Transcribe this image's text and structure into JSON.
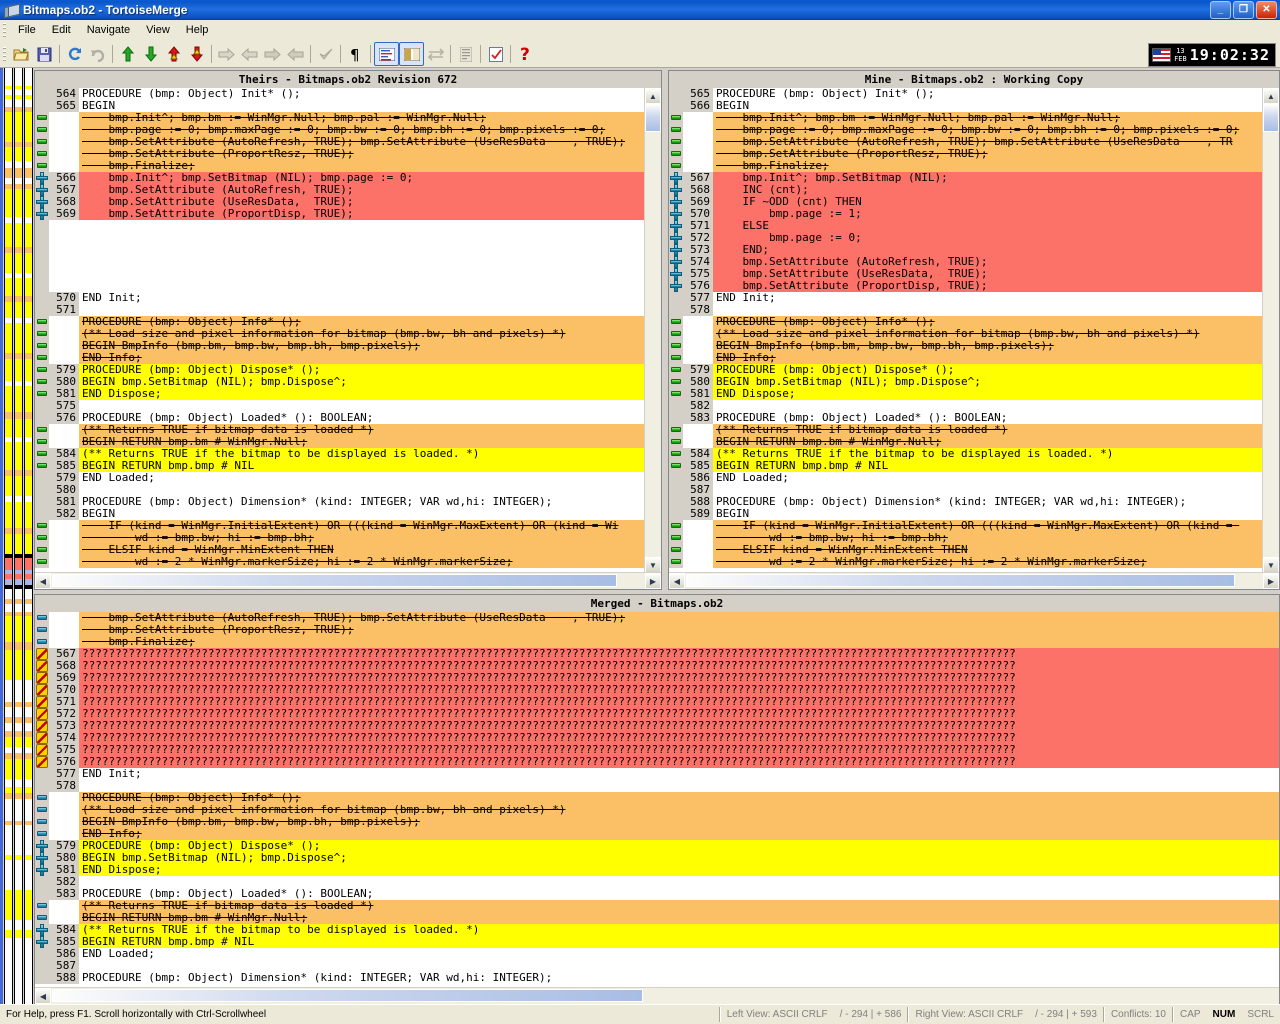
{
  "window": {
    "title": "Bitmaps.ob2 - TortoiseMerge",
    "minimize": "_",
    "maximize": "❐",
    "close": "✕"
  },
  "menu": [
    "File",
    "Edit",
    "Navigate",
    "View",
    "Help"
  ],
  "toolbar": {
    "buttons": [
      "open-icon",
      "save-icon",
      "sep",
      "reload-icon",
      "undo-icon",
      "sep",
      "prev-diff-icon",
      "next-diff-icon",
      "prev-conflict-icon",
      "next-conflict-icon",
      "sep",
      "use-theirs-block-icon",
      "use-mine-block-icon",
      "use-theirs-then-mine-icon",
      "use-mine-then-theirs-icon",
      "sep",
      "mark-resolved-icon",
      "sep",
      "whitespace-icon",
      "sep",
      "one-pane-view-icon",
      "two-pane-view-icon",
      "switch-view-icon",
      "sep",
      "three-pane-view-icon",
      "sep",
      "settings-icon",
      "sep",
      "help-icon"
    ]
  },
  "clock": {
    "day": "13",
    "month": "FEB",
    "time": "19:02:32",
    "flag": "us-flag-icon"
  },
  "panes": {
    "left": {
      "title": "Theirs - Bitmaps.ob2 Revision 672"
    },
    "right": {
      "title": "Mine - Bitmaps.ob2 : Working Copy"
    },
    "merged": {
      "title": "Merged - Bitmaps.ob2"
    }
  },
  "left_lines": [
    {
      "n": "564",
      "t": "PROCEDURE (bmp: Object) Init* ();",
      "s": "norm",
      "m": ""
    },
    {
      "n": "565",
      "t": "BEGIN",
      "s": "norm",
      "m": ""
    },
    {
      "n": "",
      "t": "    bmp.Init^; bmp.bm := WinMgr.Null; bmp.pal := WinMgr.Null;",
      "s": "rem",
      "m": "rem"
    },
    {
      "n": "",
      "t": "    bmp.page := 0; bmp.maxPage := 0; bmp.bw := 0; bmp.bh := 0; bmp.pixels := 0;",
      "s": "rem",
      "m": "rem"
    },
    {
      "n": "",
      "t": "    bmp.SetAttribute (AutoRefresh, TRUE); bmp.SetAttribute (UseResData    , TRUE);",
      "s": "rem",
      "m": "rem"
    },
    {
      "n": "",
      "t": "    bmp.SetAttribute (ProportResz, TRUE);",
      "s": "rem",
      "m": "rem"
    },
    {
      "n": "",
      "t": "    bmp.Finalize;",
      "s": "rem",
      "m": "rem"
    },
    {
      "n": "566",
      "t": "    bmp.Init^; bmp.SetBitmap (NIL); bmp.page := 0;",
      "s": "conf",
      "m": "add"
    },
    {
      "n": "567",
      "t": "    bmp.SetAttribute (AutoRefresh, TRUE);",
      "s": "conf",
      "m": "add"
    },
    {
      "n": "568",
      "t": "    bmp.SetAttribute (UseResData,  TRUE);",
      "s": "conf",
      "m": "add"
    },
    {
      "n": "569",
      "t": "    bmp.SetAttribute (ProportDisp, TRUE);",
      "s": "conf",
      "m": "add"
    },
    {
      "n": "",
      "t": "",
      "s": "conf",
      "m": ""
    },
    {
      "n": "",
      "t": "",
      "s": "conf",
      "m": ""
    },
    {
      "n": "",
      "t": "",
      "s": "conf",
      "m": ""
    },
    {
      "n": "",
      "t": "",
      "s": "conf",
      "m": ""
    },
    {
      "n": "",
      "t": "",
      "s": "conf",
      "m": ""
    },
    {
      "n": "",
      "t": "",
      "s": "conf",
      "m": ""
    },
    {
      "n": "570",
      "t": "END Init;",
      "s": "norm",
      "m": ""
    },
    {
      "n": "571",
      "t": "",
      "s": "norm",
      "m": ""
    },
    {
      "n": "",
      "t": "PROCEDURE (bmp: Object) Info* ();",
      "s": "rem",
      "m": "rem"
    },
    {
      "n": "",
      "t": "(** Load size and pixel information for bitmap (bmp.bw, bh and pixels) *)",
      "s": "rem",
      "m": "rem"
    },
    {
      "n": "",
      "t": "BEGIN BmpInfo (bmp.bm, bmp.bw, bmp.bh, bmp.pixels);",
      "s": "rem",
      "m": "rem"
    },
    {
      "n": "",
      "t": "END Info;",
      "s": "rem",
      "m": "rem"
    },
    {
      "n": "579",
      "t": "PROCEDURE (bmp: Object) Dispose* ();",
      "s": "mod",
      "m": "rem"
    },
    {
      "n": "580",
      "t": "BEGIN bmp.SetBitmap (NIL); bmp.Dispose^;",
      "s": "mod",
      "m": "rem"
    },
    {
      "n": "581",
      "t": "END Dispose;",
      "s": "mod",
      "m": "rem"
    },
    {
      "n": "575",
      "t": "",
      "s": "norm",
      "m": ""
    },
    {
      "n": "576",
      "t": "PROCEDURE (bmp: Object) Loaded* (): BOOLEAN;",
      "s": "norm",
      "m": ""
    },
    {
      "n": "",
      "t": "(** Returns TRUE if bitmap data is loaded *)",
      "s": "rem",
      "m": "rem"
    },
    {
      "n": "",
      "t": "BEGIN RETURN bmp.bm # WinMgr.Null;",
      "s": "rem",
      "m": "rem"
    },
    {
      "n": "584",
      "t": "(** Returns TRUE if the bitmap to be displayed is loaded. *)",
      "s": "mod",
      "m": "rem"
    },
    {
      "n": "585",
      "t": "BEGIN RETURN bmp.bmp # NIL",
      "s": "mod",
      "m": "rem"
    },
    {
      "n": "579",
      "t": "END Loaded;",
      "s": "norm",
      "m": ""
    },
    {
      "n": "580",
      "t": "",
      "s": "norm",
      "m": ""
    },
    {
      "n": "581",
      "t": "PROCEDURE (bmp: Object) Dimension* (kind: INTEGER; VAR wd,hi: INTEGER);",
      "s": "norm",
      "m": ""
    },
    {
      "n": "582",
      "t": "BEGIN",
      "s": "norm",
      "m": ""
    },
    {
      "n": "",
      "t": "    IF (kind = WinMgr.InitialExtent) OR (((kind = WinMgr.MaxExtent) OR (kind = Wi",
      "s": "rem",
      "m": "rem"
    },
    {
      "n": "",
      "t": "        wd := bmp.bw; hi := bmp.bh;",
      "s": "rem",
      "m": "rem"
    },
    {
      "n": "",
      "t": "    ELSIF kind = WinMgr.MinExtent THEN",
      "s": "rem",
      "m": "rem"
    },
    {
      "n": "",
      "t": "        wd := 2 * WinMgr.markerSize; hi := 2 * WinMgr.markerSize;",
      "s": "rem",
      "m": "rem"
    }
  ],
  "right_lines": [
    {
      "n": "565",
      "t": "PROCEDURE (bmp: Object) Init* ();",
      "s": "norm",
      "m": ""
    },
    {
      "n": "566",
      "t": "BEGIN",
      "s": "norm",
      "m": ""
    },
    {
      "n": "",
      "t": "    bmp.Init^; bmp.bm := WinMgr.Null; bmp.pal := WinMgr.Null;",
      "s": "rem",
      "m": "rem"
    },
    {
      "n": "",
      "t": "    bmp.page := 0; bmp.maxPage := 0; bmp.bw := 0; bmp.bh := 0; bmp.pixels := 0;",
      "s": "rem",
      "m": "rem"
    },
    {
      "n": "",
      "t": "    bmp.SetAttribute (AutoRefresh, TRUE); bmp.SetAttribute (UseResData    , TR",
      "s": "rem",
      "m": "rem"
    },
    {
      "n": "",
      "t": "    bmp.SetAttribute (ProportResz, TRUE);",
      "s": "rem",
      "m": "rem"
    },
    {
      "n": "",
      "t": "    bmp.Finalize;",
      "s": "rem",
      "m": "rem"
    },
    {
      "n": "567",
      "t": "    bmp.Init^; bmp.SetBitmap (NIL);",
      "s": "conf",
      "m": "add"
    },
    {
      "n": "568",
      "t": "    INC (cnt);",
      "s": "conf",
      "m": "add"
    },
    {
      "n": "569",
      "t": "    IF ~ODD (cnt) THEN",
      "s": "conf",
      "m": "add"
    },
    {
      "n": "570",
      "t": "        bmp.page := 1;",
      "s": "conf",
      "m": "add"
    },
    {
      "n": "571",
      "t": "    ELSE",
      "s": "conf",
      "m": "add"
    },
    {
      "n": "572",
      "t": "        bmp.page := 0;",
      "s": "conf",
      "m": "add"
    },
    {
      "n": "573",
      "t": "    END;",
      "s": "conf",
      "m": "add"
    },
    {
      "n": "574",
      "t": "    bmp.SetAttribute (AutoRefresh, TRUE);",
      "s": "conf",
      "m": "add"
    },
    {
      "n": "575",
      "t": "    bmp.SetAttribute (UseResData,  TRUE);",
      "s": "conf",
      "m": "add"
    },
    {
      "n": "576",
      "t": "    bmp.SetAttribute (ProportDisp, TRUE);",
      "s": "conf",
      "m": "add"
    },
    {
      "n": "577",
      "t": "END Init;",
      "s": "norm",
      "m": ""
    },
    {
      "n": "578",
      "t": "",
      "s": "norm",
      "m": ""
    },
    {
      "n": "",
      "t": "PROCEDURE (bmp: Object) Info* ();",
      "s": "rem",
      "m": "rem"
    },
    {
      "n": "",
      "t": "(** Load size and pixel information for bitmap (bmp.bw, bh and pixels) *)",
      "s": "rem",
      "m": "rem"
    },
    {
      "n": "",
      "t": "BEGIN BmpInfo (bmp.bm, bmp.bw, bmp.bh, bmp.pixels);",
      "s": "rem",
      "m": "rem"
    },
    {
      "n": "",
      "t": "END Info;",
      "s": "rem",
      "m": "rem"
    },
    {
      "n": "579",
      "t": "PROCEDURE (bmp: Object) Dispose* ();",
      "s": "mod",
      "m": "rem"
    },
    {
      "n": "580",
      "t": "BEGIN bmp.SetBitmap (NIL); bmp.Dispose^;",
      "s": "mod",
      "m": "rem"
    },
    {
      "n": "581",
      "t": "END Dispose;",
      "s": "mod",
      "m": "rem"
    },
    {
      "n": "582",
      "t": "",
      "s": "norm",
      "m": ""
    },
    {
      "n": "583",
      "t": "PROCEDURE (bmp: Object) Loaded* (): BOOLEAN;",
      "s": "norm",
      "m": ""
    },
    {
      "n": "",
      "t": "(** Returns TRUE if bitmap data is loaded *)",
      "s": "rem",
      "m": "rem"
    },
    {
      "n": "",
      "t": "BEGIN RETURN bmp.bm # WinMgr.Null;",
      "s": "rem",
      "m": "rem"
    },
    {
      "n": "584",
      "t": "(** Returns TRUE if the bitmap to be displayed is loaded. *)",
      "s": "mod",
      "m": "rem"
    },
    {
      "n": "585",
      "t": "BEGIN RETURN bmp.bmp # NIL",
      "s": "mod",
      "m": "rem"
    },
    {
      "n": "586",
      "t": "END Loaded;",
      "s": "norm",
      "m": ""
    },
    {
      "n": "587",
      "t": "",
      "s": "norm",
      "m": ""
    },
    {
      "n": "588",
      "t": "PROCEDURE (bmp: Object) Dimension* (kind: INTEGER; VAR wd,hi: INTEGER);",
      "s": "norm",
      "m": ""
    },
    {
      "n": "589",
      "t": "BEGIN",
      "s": "norm",
      "m": ""
    },
    {
      "n": "",
      "t": "    IF (kind = WinMgr.InitialExtent) OR (((kind = WinMgr.MaxExtent) OR (kind = ",
      "s": "rem",
      "m": "rem"
    },
    {
      "n": "",
      "t": "        wd := bmp.bw; hi := bmp.bh;",
      "s": "rem",
      "m": "rem"
    },
    {
      "n": "",
      "t": "    ELSIF kind = WinMgr.MinExtent THEN",
      "s": "rem",
      "m": "rem"
    },
    {
      "n": "",
      "t": "        wd := 2 * WinMgr.markerSize; hi := 2 * WinMgr.markerSize;",
      "s": "rem",
      "m": "rem"
    }
  ],
  "merged_lines": [
    {
      "n": "",
      "t": "    bmp.SetAttribute (AutoRefresh, TRUE); bmp.SetAttribute (UseResData    , TRUE);",
      "s": "rem",
      "m": "teal"
    },
    {
      "n": "",
      "t": "    bmp.SetAttribute (ProportResz, TRUE);",
      "s": "rem",
      "m": "teal"
    },
    {
      "n": "",
      "t": "    bmp.Finalize;",
      "s": "rem",
      "m": "teal"
    },
    {
      "n": "567",
      "t": "?????????????????????????????????????????????????????????????????????????????????????????????????????????????????????????????????????????????",
      "s": "conf",
      "m": "conf"
    },
    {
      "n": "568",
      "t": "?????????????????????????????????????????????????????????????????????????????????????????????????????????????????????????????????????????????",
      "s": "conf",
      "m": "conf"
    },
    {
      "n": "569",
      "t": "?????????????????????????????????????????????????????????????????????????????????????????????????????????????????????????????????????????????",
      "s": "conf",
      "m": "conf"
    },
    {
      "n": "570",
      "t": "?????????????????????????????????????????????????????????????????????????????????????????????????????????????????????????????????????????????",
      "s": "conf",
      "m": "conf"
    },
    {
      "n": "571",
      "t": "?????????????????????????????????????????????????????????????????????????????????????????????????????????????????????????????????????????????",
      "s": "conf",
      "m": "conf"
    },
    {
      "n": "572",
      "t": "?????????????????????????????????????????????????????????????????????????????????????????????????????????????????????????????????????????????",
      "s": "conf",
      "m": "conf"
    },
    {
      "n": "573",
      "t": "?????????????????????????????????????????????????????????????????????????????????????????????????????????????????????????????????????????????",
      "s": "conf",
      "m": "conf"
    },
    {
      "n": "574",
      "t": "?????????????????????????????????????????????????????????????????????????????????????????????????????????????????????????????????????????????",
      "s": "conf",
      "m": "conf"
    },
    {
      "n": "575",
      "t": "?????????????????????????????????????????????????????????????????????????????????????????????????????????????????????????????????????????????",
      "s": "conf",
      "m": "conf"
    },
    {
      "n": "576",
      "t": "?????????????????????????????????????????????????????????????????????????????????????????????????????????????????????????????????????????????",
      "s": "conf",
      "m": "conf"
    },
    {
      "n": "577",
      "t": "END Init;",
      "s": "norm",
      "m": ""
    },
    {
      "n": "578",
      "t": "",
      "s": "norm",
      "m": ""
    },
    {
      "n": "",
      "t": "PROCEDURE (bmp: Object) Info* ();",
      "s": "rem",
      "m": "teal"
    },
    {
      "n": "",
      "t": "(** Load size and pixel information for bitmap (bmp.bw, bh and pixels) *)",
      "s": "rem",
      "m": "teal"
    },
    {
      "n": "",
      "t": "BEGIN BmpInfo (bmp.bm, bmp.bw, bmp.bh, bmp.pixels);",
      "s": "rem",
      "m": "teal"
    },
    {
      "n": "",
      "t": "END Info;",
      "s": "rem",
      "m": "teal"
    },
    {
      "n": "579",
      "t": "PROCEDURE (bmp: Object) Dispose* ();",
      "s": "mod",
      "m": "add"
    },
    {
      "n": "580",
      "t": "BEGIN bmp.SetBitmap (NIL); bmp.Dispose^;",
      "s": "mod",
      "m": "add"
    },
    {
      "n": "581",
      "t": "END Dispose;",
      "s": "mod",
      "m": "add"
    },
    {
      "n": "582",
      "t": "",
      "s": "norm",
      "m": ""
    },
    {
      "n": "583",
      "t": "PROCEDURE (bmp: Object) Loaded* (): BOOLEAN;",
      "s": "norm",
      "m": ""
    },
    {
      "n": "",
      "t": "(** Returns TRUE if bitmap data is loaded *)",
      "s": "rem",
      "m": "teal"
    },
    {
      "n": "",
      "t": "BEGIN RETURN bmp.bm # WinMgr.Null;",
      "s": "rem",
      "m": "teal"
    },
    {
      "n": "584",
      "t": "(** Returns TRUE if the bitmap to be displayed is loaded. *)",
      "s": "mod",
      "m": "add"
    },
    {
      "n": "585",
      "t": "BEGIN RETURN bmp.bmp # NIL",
      "s": "mod",
      "m": "add"
    },
    {
      "n": "586",
      "t": "END Loaded;",
      "s": "norm",
      "m": ""
    },
    {
      "n": "587",
      "t": "",
      "s": "norm",
      "m": ""
    },
    {
      "n": "588",
      "t": "PROCEDURE (bmp: Object) Dimension* (kind: INTEGER; VAR wd,hi: INTEGER);",
      "s": "norm",
      "m": ""
    }
  ],
  "status": {
    "hint": "For Help, press F1. Scroll horizontally with Ctrl-Scrollwheel",
    "left_view": "Left View: ASCII CRLF",
    "left_counts": "/ - 294 | + 586",
    "right_view": "Right View: ASCII CRLF",
    "right_counts": "/ - 294 | + 593",
    "conflicts": "Conflicts: 10",
    "caps": "CAP",
    "num": "NUM",
    "scrl": "SCRL"
  },
  "colors": {
    "removed": "#fbbf66",
    "conflict": "#fc7268",
    "modified": "#ffff00",
    "normal": "#ffffff",
    "accent": "#316ac5"
  }
}
